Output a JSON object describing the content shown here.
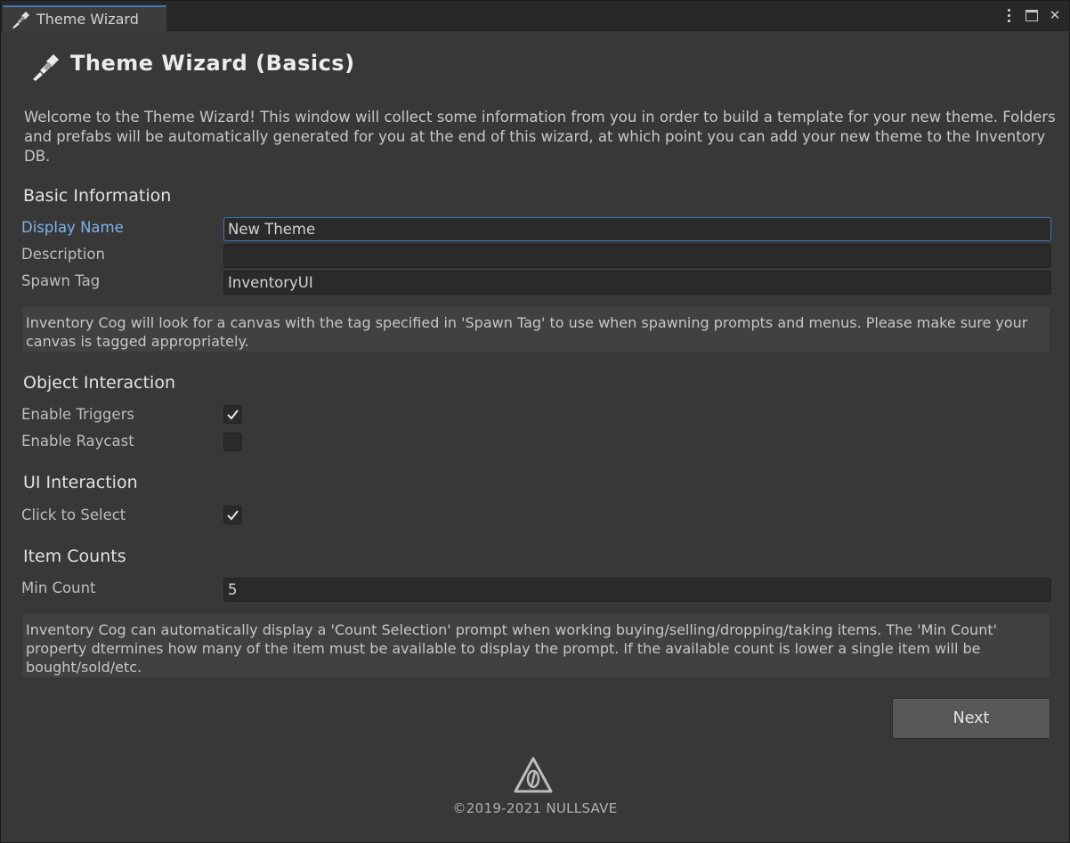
{
  "tab": {
    "title": "Theme Wizard",
    "icon": "paintbrush-icon"
  },
  "window_controls": {
    "more": "kebab-menu-icon",
    "maximize": "maximize-icon",
    "close": "✕"
  },
  "header": {
    "title": "Theme Wizard (Basics)",
    "icon": "paintbrush-icon"
  },
  "intro": "Welcome to the Theme Wizard! This window will collect some information from you in order to build a template for your new theme. Folders and prefabs will be automatically generated for you at the end of this wizard, at which point you can add your new theme to the Inventory DB.",
  "basic_info": {
    "title": "Basic Information",
    "display_name": {
      "label": "Display Name",
      "value": "New Theme"
    },
    "description": {
      "label": "Description",
      "value": ""
    },
    "spawn_tag": {
      "label": "Spawn Tag",
      "value": "InventoryUI"
    },
    "help": "Inventory Cog will look for a canvas with the tag specified in 'Spawn Tag' to use when spawning prompts and menus. Please make sure your canvas is tagged appropriately."
  },
  "object_interaction": {
    "title": "Object Interaction",
    "enable_triggers": {
      "label": "Enable Triggers",
      "checked": true
    },
    "enable_raycast": {
      "label": "Enable Raycast",
      "checked": false
    }
  },
  "ui_interaction": {
    "title": "UI Interaction",
    "click_to_select": {
      "label": "Click to Select",
      "checked": true
    }
  },
  "item_counts": {
    "title": "Item Counts",
    "min_count": {
      "label": "Min Count",
      "value": "5"
    },
    "help": "Inventory Cog can automatically display a 'Count Selection' prompt when working buying/selling/dropping/taking items. The 'Min Count' property dtermines how many of the item must be available to display the prompt. If the available count is lower a single item will be bought/sold/etc."
  },
  "next_button": "Next",
  "footer": {
    "logo": "nullsave-logo",
    "copyright": "©2019-2021 NULLSAVE"
  },
  "colors": {
    "accent": "#3a79bb",
    "active_label": "#7fb2ea",
    "background": "#383838"
  }
}
